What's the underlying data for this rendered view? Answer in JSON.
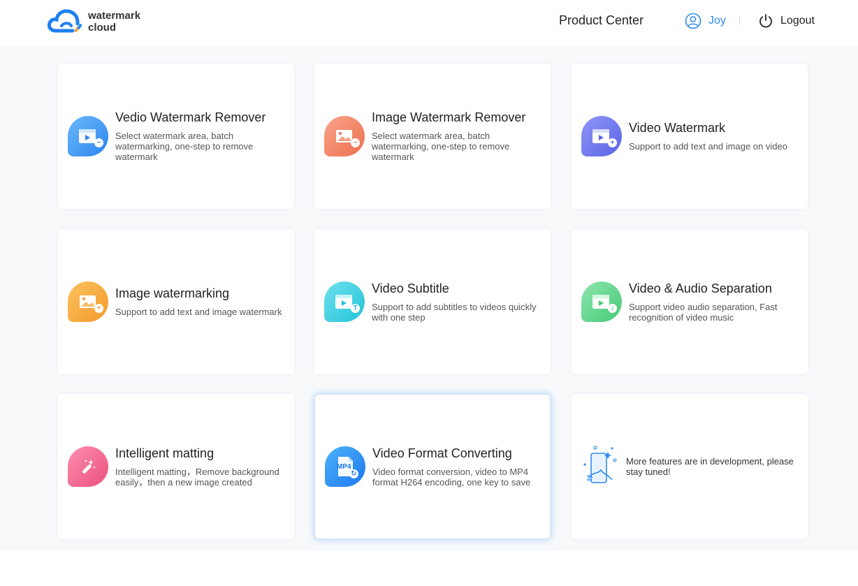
{
  "header": {
    "logo_line1": "watermark",
    "logo_line2": "cloud",
    "product_center": "Product Center",
    "user_name": "Joy",
    "logout": "Logout"
  },
  "colors": {
    "accent": "#2d8cf0",
    "blue": "#3a8ef0",
    "orange": "#f27e5e",
    "purple": "#6b74ee",
    "yellow": "#f7a93a",
    "cyan": "#36cde0",
    "green": "#5fd68e",
    "pink": "#f2608b"
  },
  "cards": [
    {
      "icon": "video-remove-icon",
      "title": "Vedio Watermark Remover",
      "desc": "Select watermark area, batch watermarking, one-step to remove watermark"
    },
    {
      "icon": "image-remove-icon",
      "title": "Image Watermark Remover",
      "desc": "Select watermark area, batch watermarking, one-step to remove watermark"
    },
    {
      "icon": "video-add-icon",
      "title": "Video Watermark",
      "desc": "Support to add text and image on video"
    },
    {
      "icon": "image-add-icon",
      "title": "Image watermarking",
      "desc": "Support to add text and image watermark"
    },
    {
      "icon": "video-subtitle-icon",
      "title": "Video Subtitle",
      "desc": "Support to add subtitles to videos quickly with one step"
    },
    {
      "icon": "video-audio-icon",
      "title": "Video & Audio Separation",
      "desc": "Support video audio separation, Fast recognition of video music"
    },
    {
      "icon": "magic-wand-icon",
      "title": "Intelligent matting",
      "desc": "Intelligent matting，Remove background easily，then a new image created"
    },
    {
      "icon": "mp4-convert-icon",
      "title": "Video Format Converting",
      "desc": "Video format conversion, video to MP4 format H264 encoding, one key to save",
      "mp4_label": "MP4"
    },
    {
      "icon": "development-illustration-icon",
      "title": "",
      "desc": "More features are in development, please stay tuned!"
    }
  ]
}
